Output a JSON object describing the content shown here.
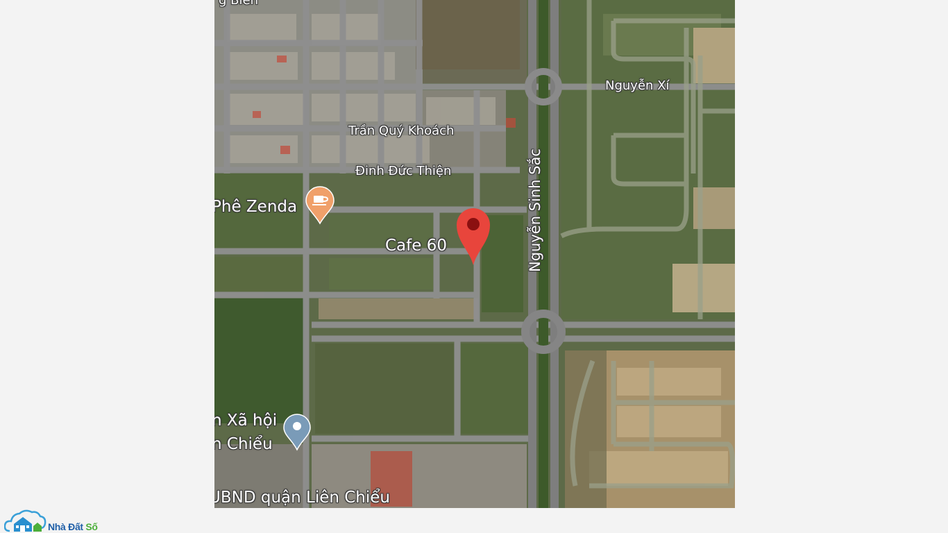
{
  "map": {
    "street_labels": {
      "top_cut": "g Biên",
      "nguyen_xi": "Nguyễn Xí",
      "tran_quy_khoach": "Trần Quý Khoách",
      "dinh_duc_thien": "Đinh Đức Thiện",
      "nguyen_sinh_sac": "Nguyễn Sinh Sắc"
    },
    "poi_labels": {
      "cafe_zenda": "Phê Zenda",
      "cafe_60": "Cafe 60",
      "xa_hoi_line1": "n Xã hội",
      "xa_hoi_line2": "n Chiểu",
      "ubnd": "UBND quận Liên Chiểu"
    },
    "markers": {
      "cafe_icon": "coffee-cup-icon",
      "cafe_color": "#f0a06a",
      "selected_color": "#e8453c",
      "selected_dot_color": "#8b1010",
      "place_color": "#7a9bb8"
    }
  },
  "logo": {
    "part1": "Nhà Đất ",
    "part2": "Số",
    "color1": "#1f5fa8",
    "color2": "#4caf3a",
    "icon": "house-cloud-icon"
  }
}
